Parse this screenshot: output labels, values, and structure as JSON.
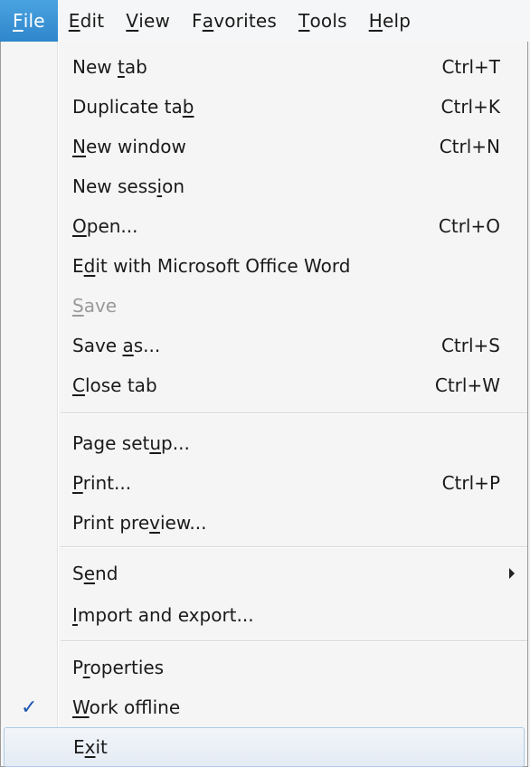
{
  "menubar": {
    "items": [
      {
        "pre": "",
        "u": "F",
        "post": "ile"
      },
      {
        "pre": "",
        "u": "E",
        "post": "dit"
      },
      {
        "pre": "",
        "u": "V",
        "post": "iew"
      },
      {
        "pre": "F",
        "u": "a",
        "post": "vorites"
      },
      {
        "pre": "",
        "u": "T",
        "post": "ools"
      },
      {
        "pre": "",
        "u": "H",
        "post": "elp"
      }
    ]
  },
  "file_menu": {
    "items": [
      {
        "pre": "New ",
        "u": "t",
        "post": "ab",
        "shortcut": "Ctrl+T"
      },
      {
        "pre": "Duplicate ta",
        "u": "b",
        "post": "",
        "shortcut": "Ctrl+K"
      },
      {
        "pre": "",
        "u": "N",
        "post": "ew window",
        "shortcut": "Ctrl+N"
      },
      {
        "pre": "New sess",
        "u": "i",
        "post": "on",
        "shortcut": ""
      },
      {
        "pre": "",
        "u": "O",
        "post": "pen...",
        "shortcut": "Ctrl+O"
      },
      {
        "pre": "E",
        "u": "d",
        "post": "it with Microsoft Office Word",
        "shortcut": ""
      },
      {
        "pre": "",
        "u": "S",
        "post": "ave",
        "shortcut": ""
      },
      {
        "pre": "Save ",
        "u": "a",
        "post": "s...",
        "shortcut": "Ctrl+S"
      },
      {
        "pre": "",
        "u": "C",
        "post": "lose tab",
        "shortcut": "Ctrl+W"
      },
      {
        "pre": "Page set",
        "u": "u",
        "post": "p...",
        "shortcut": ""
      },
      {
        "pre": "",
        "u": "P",
        "post": "rint...",
        "shortcut": "Ctrl+P"
      },
      {
        "pre": "Print pre",
        "u": "v",
        "post": "iew...",
        "shortcut": ""
      },
      {
        "pre": "S",
        "u": "e",
        "post": "nd",
        "shortcut": ""
      },
      {
        "pre": "",
        "u": "I",
        "post": "mport and export...",
        "shortcut": ""
      },
      {
        "pre": "P",
        "u": "r",
        "post": "operties",
        "shortcut": ""
      },
      {
        "pre": "",
        "u": "W",
        "post": "ork offline",
        "shortcut": ""
      },
      {
        "pre": "E",
        "u": "x",
        "post": "it",
        "shortcut": ""
      }
    ],
    "check_glyph": "✓"
  },
  "colors": {
    "accent": "#2f86cc",
    "disabled_text": "#9a9a9a",
    "hover_border": "#aecbe8"
  }
}
